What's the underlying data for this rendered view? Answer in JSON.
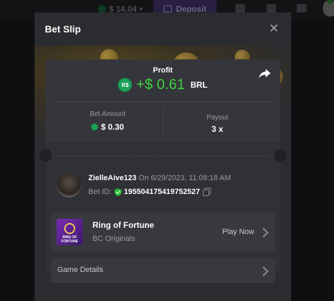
{
  "header": {
    "balance": "$ 14.04",
    "deposit_label": "Deposit"
  },
  "modal": {
    "title": "Bet Slip",
    "profit": {
      "label": "Profit",
      "currency_badge": "R$",
      "value": "+$ 0.61",
      "currency": "BRL"
    },
    "bet_amount": {
      "label": "Bet Amount",
      "value": "$ 0.30"
    },
    "payout": {
      "label": "Payout",
      "value": "3 x"
    },
    "user": {
      "name": "ZielleAive123",
      "date_text": " On 6/29/2023, 11:08:18 AM",
      "bet_id_label": "Bet ID:",
      "bet_id": "195504175419752527"
    },
    "game": {
      "name": "Ring of Fortune",
      "provider": "BC Originals",
      "play_now": "Play Now",
      "thumb_text": "RING OF FORTUNE"
    },
    "details_label": "Game Details"
  },
  "colors": {
    "profit_green": "#3fd23f",
    "brl_coin": "#1a9f57",
    "modal_bg": "#2b2c30",
    "card_bg": "#303136"
  }
}
